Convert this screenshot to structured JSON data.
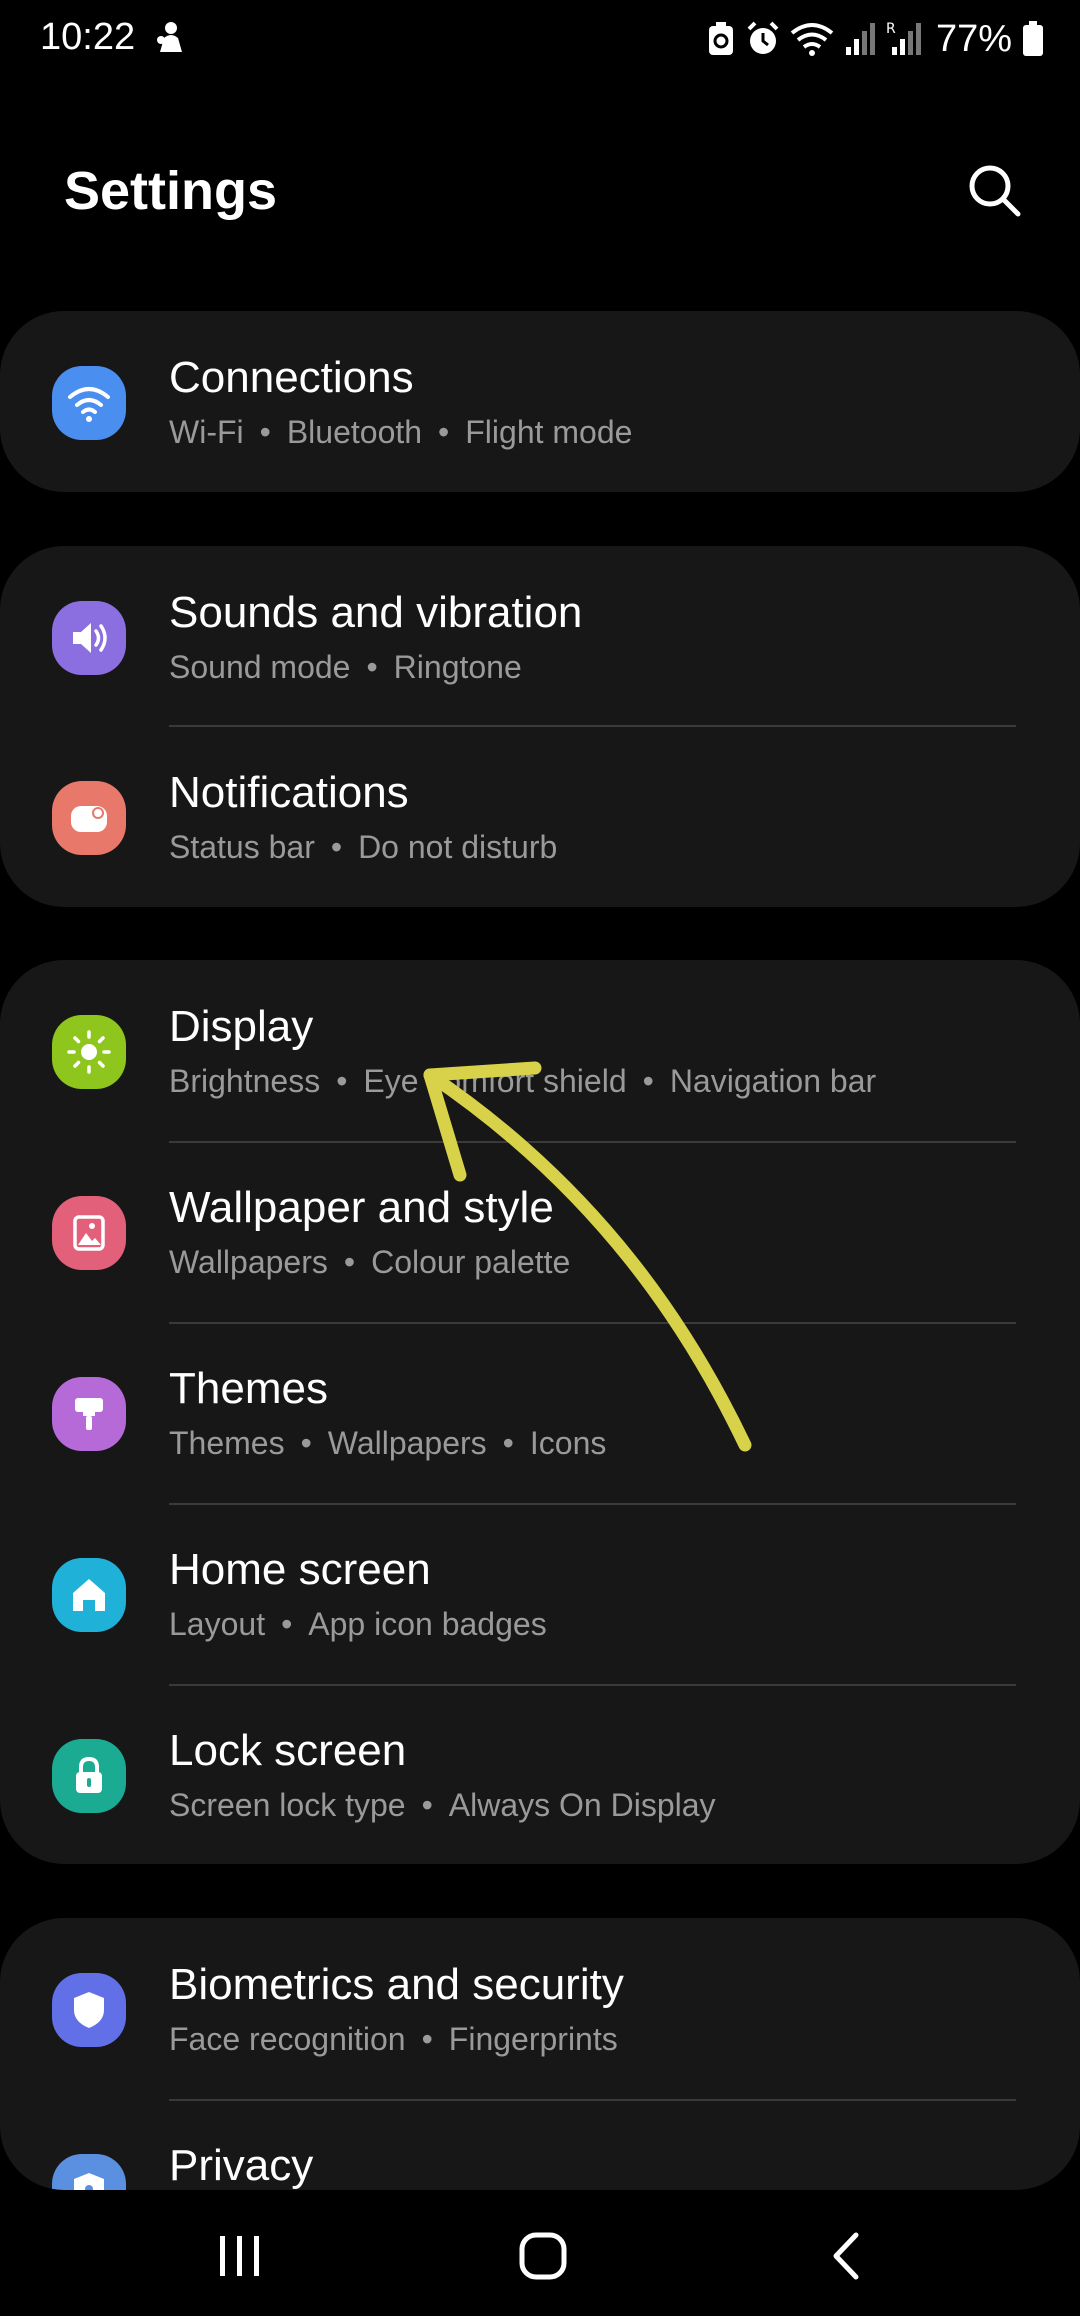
{
  "status_bar": {
    "time": "10:22",
    "battery_percent": "77%",
    "icons": [
      "notification-icon",
      "battery-saver-icon",
      "alarm-icon",
      "wifi-icon",
      "signal-icon",
      "roaming-signal-icon",
      "battery-icon"
    ]
  },
  "header": {
    "title": "Settings",
    "search_icon": "search-icon"
  },
  "groups": [
    {
      "items": [
        {
          "title": "Connections",
          "subtitle": [
            "Wi-Fi",
            "Bluetooth",
            "Flight mode"
          ],
          "icon": "wifi-icon",
          "icon_color": "#4a8ff0"
        }
      ]
    },
    {
      "items": [
        {
          "title": "Sounds and vibration",
          "subtitle": [
            "Sound mode",
            "Ringtone"
          ],
          "icon": "volume-icon",
          "icon_color": "#8b6fe0"
        },
        {
          "title": "Notifications",
          "subtitle": [
            "Status bar",
            "Do not disturb"
          ],
          "icon": "notification-bell-icon",
          "icon_color": "#e8786a"
        }
      ]
    },
    {
      "items": [
        {
          "title": "Display",
          "subtitle": [
            "Brightness",
            "Eye comfort shield",
            "Navigation bar"
          ],
          "icon": "brightness-icon",
          "icon_color": "#8fc61e"
        },
        {
          "title": "Wallpaper and style",
          "subtitle": [
            "Wallpapers",
            "Colour palette"
          ],
          "icon": "wallpaper-icon",
          "icon_color": "#e3607a"
        },
        {
          "title": "Themes",
          "subtitle": [
            "Themes",
            "Wallpapers",
            "Icons"
          ],
          "icon": "theme-brush-icon",
          "icon_color": "#b56ad8"
        },
        {
          "title": "Home screen",
          "subtitle": [
            "Layout",
            "App icon badges"
          ],
          "icon": "home-icon",
          "icon_color": "#1fb1d8"
        },
        {
          "title": "Lock screen",
          "subtitle": [
            "Screen lock type",
            "Always On Display"
          ],
          "icon": "lock-icon",
          "icon_color": "#1aab92"
        }
      ]
    },
    {
      "items": [
        {
          "title": "Biometrics and security",
          "subtitle": [
            "Face recognition",
            "Fingerprints"
          ],
          "icon": "shield-icon",
          "icon_color": "#6270e8"
        },
        {
          "title": "Privacy",
          "subtitle": [],
          "icon": "privacy-shield-icon",
          "icon_color": "#5b8fe0"
        }
      ]
    }
  ],
  "annotation": {
    "type": "arrow",
    "color": "#d8d24a",
    "points_to": "Display"
  },
  "nav_bar": {
    "buttons": [
      "recents-icon",
      "home-button-icon",
      "back-icon"
    ]
  }
}
